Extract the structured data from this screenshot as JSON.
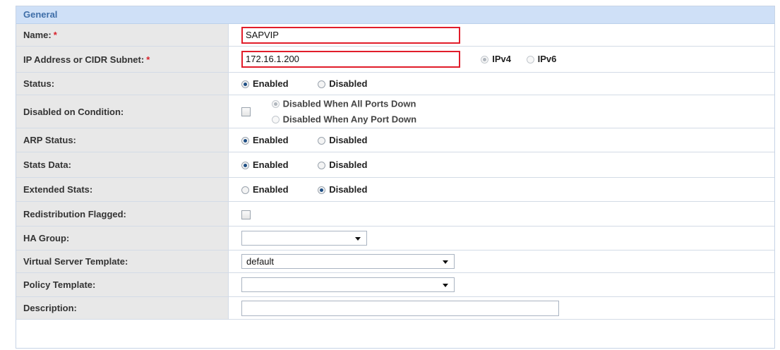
{
  "section": {
    "title": "General"
  },
  "fields": {
    "name": {
      "label": "Name:",
      "required": "*",
      "value": "SAPVIP"
    },
    "ip": {
      "label": "IP Address or CIDR Subnet:",
      "required": "*",
      "value": "172.16.1.200",
      "ipv4": "IPv4",
      "ipv6": "IPv6",
      "selected": "IPv4"
    },
    "status": {
      "label": "Status:",
      "opt1": "Enabled",
      "opt2": "Disabled",
      "selected": "Enabled"
    },
    "disabled_condition": {
      "label": "Disabled on Condition:",
      "checked": false,
      "opt1": "Disabled When All Ports Down",
      "opt2": "Disabled When Any Port Down",
      "selected": "Disabled When All Ports Down"
    },
    "arp_status": {
      "label": "ARP Status:",
      "opt1": "Enabled",
      "opt2": "Disabled",
      "selected": "Enabled"
    },
    "stats_data": {
      "label": "Stats Data:",
      "opt1": "Enabled",
      "opt2": "Disabled",
      "selected": "Enabled"
    },
    "extended_stats": {
      "label": "Extended Stats:",
      "opt1": "Enabled",
      "opt2": "Disabled",
      "selected": "Disabled"
    },
    "redistribution": {
      "label": "Redistribution Flagged:",
      "checked": false
    },
    "ha_group": {
      "label": "HA Group:",
      "value": ""
    },
    "vs_template": {
      "label": "Virtual Server Template:",
      "value": "default"
    },
    "policy_template": {
      "label": "Policy Template:",
      "value": ""
    },
    "description": {
      "label": "Description:",
      "value": ""
    }
  },
  "colors": {
    "header_bg": "#cfe0f7",
    "header_text": "#3f6ea8",
    "label_bg": "#e8e8e8",
    "required": "#d8222b",
    "highlight": "#e11d2a"
  }
}
